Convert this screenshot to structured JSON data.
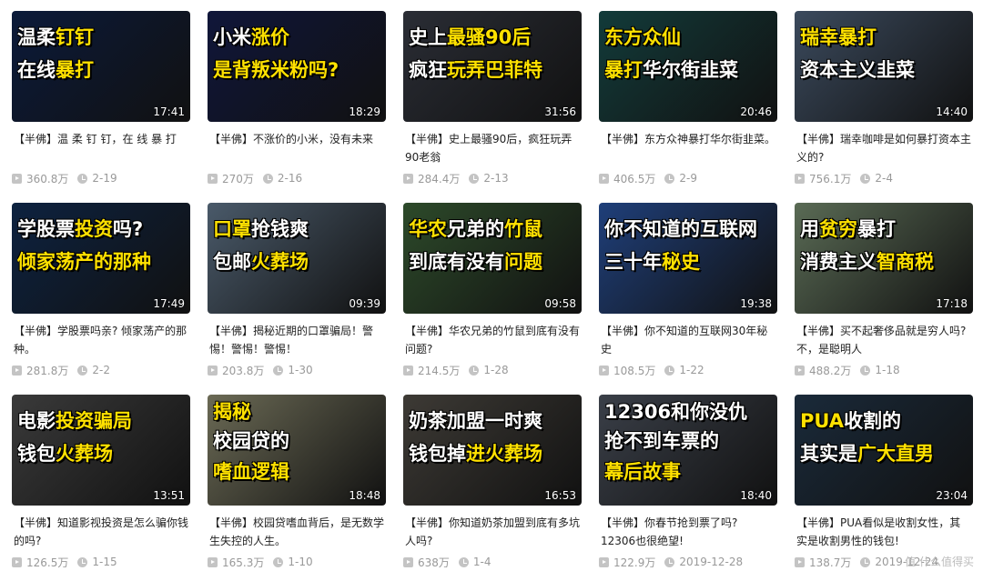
{
  "videos": [
    {
      "t1": [
        {
          "t": "温柔",
          "c": "w"
        },
        {
          "t": "钉钉",
          "c": "y"
        }
      ],
      "t2": [
        {
          "t": "在线",
          "c": "w"
        },
        {
          "t": "暴打",
          "c": "y"
        }
      ],
      "duration": "17:41",
      "desc": "【半佛】温 柔 钉 钉，在 线 暴 打",
      "views": "360.8万",
      "date": "2-19",
      "bg": "#0b1a3a"
    },
    {
      "t1": [
        {
          "t": "小米",
          "c": "w"
        },
        {
          "t": "涨价",
          "c": "y"
        }
      ],
      "t2": [
        {
          "t": "是背叛米粉吗?",
          "c": "y"
        }
      ],
      "duration": "18:29",
      "desc": "【半佛】不涨价的小米，没有未来",
      "views": "270万",
      "date": "2-16",
      "bg": "#10163a"
    },
    {
      "t1": [
        {
          "t": "史上",
          "c": "w"
        },
        {
          "t": "最骚90后",
          "c": "y"
        }
      ],
      "t2": [
        {
          "t": "疯狂",
          "c": "w"
        },
        {
          "t": "玩弄巴菲特",
          "c": "y"
        }
      ],
      "duration": "31:56",
      "desc": "【半佛】史上最骚90后，疯狂玩弄90老翁",
      "views": "284.4万",
      "date": "2-13",
      "bg": "#2a2d35"
    },
    {
      "t1": [
        {
          "t": "东方众仙",
          "c": "y"
        }
      ],
      "t2": [
        {
          "t": "暴打",
          "c": "y"
        },
        {
          "t": "华尔街韭菜",
          "c": "w"
        }
      ],
      "duration": "20:46",
      "desc": "【半佛】东方众神暴打华尔街韭菜。",
      "views": "406.5万",
      "date": "2-9",
      "bg": "#123b3a"
    },
    {
      "t1": [
        {
          "t": "瑞幸暴打",
          "c": "y"
        }
      ],
      "t2": [
        {
          "t": "资本主义韭菜",
          "c": "w"
        }
      ],
      "duration": "14:40",
      "desc": "【半佛】瑞幸咖啡是如何暴打资本主义的?",
      "views": "756.1万",
      "date": "2-4",
      "bg": "#3b4a5d"
    },
    {
      "t1": [
        {
          "t": "学股票",
          "c": "w"
        },
        {
          "t": "投资",
          "c": "y"
        },
        {
          "t": "吗?",
          "c": "w"
        }
      ],
      "t2": [
        {
          "t": "倾家荡产的那种",
          "c": "y"
        }
      ],
      "duration": "17:49",
      "desc": "【半佛】学股票吗亲? 倾家荡产的那种。",
      "views": "281.8万",
      "date": "2-2",
      "bg": "#0d2240"
    },
    {
      "t1": [
        {
          "t": "口罩",
          "c": "y"
        },
        {
          "t": "抢钱爽",
          "c": "w"
        }
      ],
      "t2": [
        {
          "t": "包邮",
          "c": "w"
        },
        {
          "t": "火葬场",
          "c": "y"
        }
      ],
      "duration": "09:39",
      "desc": "【半佛】揭秘近期的口罩骗局！警惕！警惕！警惕！",
      "views": "203.8万",
      "date": "1-30",
      "bg": "#4a5a6a"
    },
    {
      "t1": [
        {
          "t": "华农",
          "c": "y"
        },
        {
          "t": "兄弟的",
          "c": "w"
        },
        {
          "t": "竹鼠",
          "c": "y"
        }
      ],
      "t2": [
        {
          "t": "到底有没有",
          "c": "w"
        },
        {
          "t": "问题",
          "c": "y"
        }
      ],
      "duration": "09:58",
      "desc": "【半佛】华农兄弟的竹鼠到底有没有问题?",
      "views": "214.5万",
      "date": "1-28",
      "bg": "#2d4a2a"
    },
    {
      "t1": [
        {
          "t": "你不知道的互联网",
          "c": "w"
        }
      ],
      "t2": [
        {
          "t": "三十年",
          "c": "w"
        },
        {
          "t": "秘史",
          "c": "y"
        }
      ],
      "duration": "19:38",
      "desc": "【半佛】你不知道的互联网30年秘史",
      "views": "108.5万",
      "date": "1-22",
      "bg": "#1f3f7a"
    },
    {
      "t1": [
        {
          "t": "用",
          "c": "w"
        },
        {
          "t": "贫穷",
          "c": "y"
        },
        {
          "t": "暴打",
          "c": "w"
        }
      ],
      "t2": [
        {
          "t": "消费主义",
          "c": "w"
        },
        {
          "t": "智商税",
          "c": "y"
        }
      ],
      "duration": "17:18",
      "desc": "【半佛】买不起奢侈品就是穷人吗? 不，是聪明人",
      "views": "488.2万",
      "date": "1-18",
      "bg": "#5a6b55"
    },
    {
      "t1": [
        {
          "t": "电影",
          "c": "w"
        },
        {
          "t": "投资骗局",
          "c": "y"
        }
      ],
      "t2": [
        {
          "t": "钱包",
          "c": "w"
        },
        {
          "t": "火葬场",
          "c": "y"
        }
      ],
      "duration": "13:51",
      "desc": "【半佛】知道影视投资是怎么骗你钱的吗?",
      "views": "126.5万",
      "date": "1-15",
      "bg": "#3a3a3a"
    },
    {
      "t1": [
        {
          "t": "揭秘",
          "c": "y"
        }
      ],
      "t2": [
        {
          "t": "校园贷",
          "c": "w"
        },
        {
          "t": "的",
          "c": "w"
        }
      ],
      "t3": [
        {
          "t": "嗜血逻辑",
          "c": "y"
        }
      ],
      "duration": "18:48",
      "desc": "【半佛】校园贷嗜血背后，是无数学生失控的人生。",
      "views": "165.3万",
      "date": "1-10",
      "bg": "#6b6a55"
    },
    {
      "t1": [
        {
          "t": "奶茶加盟",
          "c": "w"
        },
        {
          "t": "一时爽",
          "c": "w"
        }
      ],
      "t2": [
        {
          "t": "钱包掉",
          "c": "w"
        },
        {
          "t": "进火葬场",
          "c": "y"
        }
      ],
      "duration": "16:53",
      "desc": "【半佛】你知道奶茶加盟到底有多坑人吗?",
      "views": "638万",
      "date": "1-4",
      "bg": "#3d3a35"
    },
    {
      "t1": [
        {
          "t": "12306和你没仇",
          "c": "w"
        }
      ],
      "t2": [
        {
          "t": "抢不到车票的",
          "c": "w"
        }
      ],
      "t3": [
        {
          "t": "幕后故事",
          "c": "y"
        }
      ],
      "duration": "18:40",
      "desc": "【半佛】你春节抢到票了吗? 12306也很绝望!",
      "views": "122.9万",
      "date": "2019-12-28",
      "bg": "#3a3f48"
    },
    {
      "t1": [
        {
          "t": "PUA",
          "c": "y"
        },
        {
          "t": "收割的",
          "c": "w"
        }
      ],
      "t2": [
        {
          "t": "其实是",
          "c": "w"
        },
        {
          "t": "广大直男",
          "c": "y"
        }
      ],
      "duration": "23:04",
      "desc": "【半佛】PUA看似是收割女性，其实是收割男性的钱包!",
      "views": "138.7万",
      "date": "2019-12-24",
      "bg": "#1a2a3a"
    }
  ],
  "watermark": "值 什么值得买"
}
